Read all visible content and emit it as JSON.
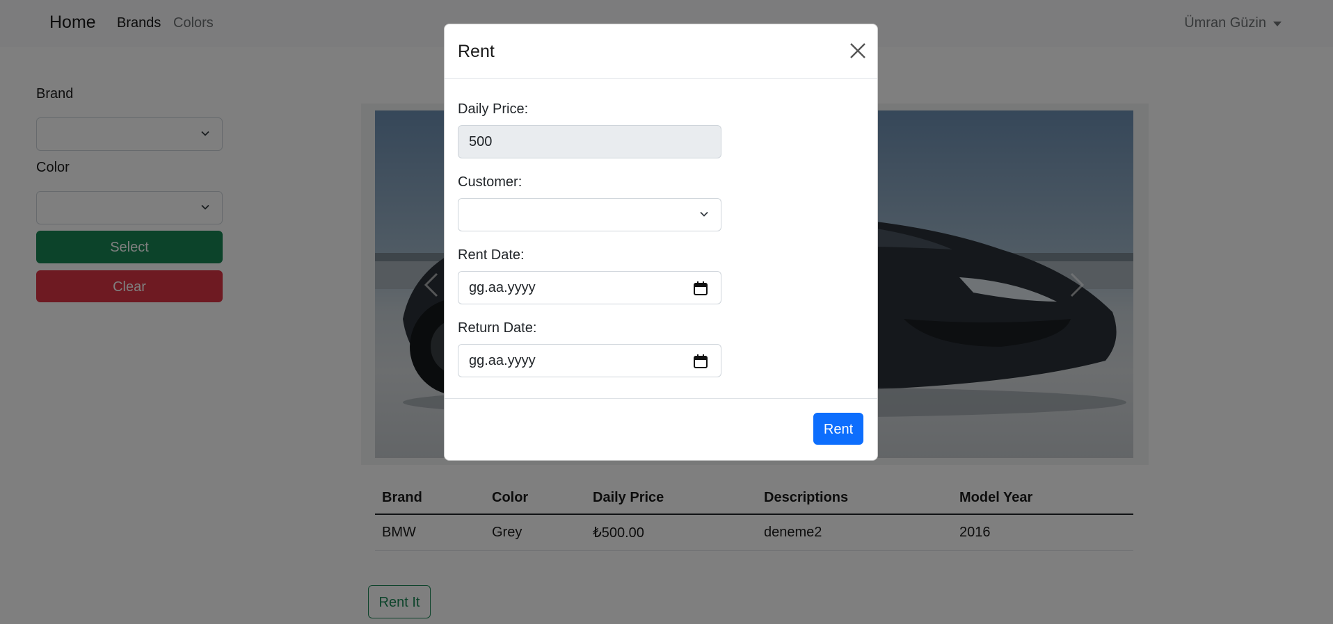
{
  "navbar": {
    "home_label": "Home",
    "links": [
      {
        "label": "Brands"
      },
      {
        "label": "Colors"
      }
    ],
    "user_name": "Ümran Güzin"
  },
  "filters": {
    "brand_label": "Brand",
    "brand_value": "",
    "color_label": "Color",
    "color_value": "",
    "select_button": "Select",
    "clear_button": "Clear"
  },
  "table": {
    "headers": [
      "Brand",
      "Color",
      "Daily Price",
      "Descriptions",
      "Model Year"
    ],
    "rows": [
      [
        "BMW",
        "Grey",
        "₺500.00",
        "deneme2",
        "2016"
      ]
    ]
  },
  "rent_it_button": "Rent It",
  "modal": {
    "title": "Rent",
    "daily_price_label": "Daily Price:",
    "daily_price_value": "500",
    "customer_label": "Customer:",
    "customer_value": "",
    "rent_date_label": "Rent Date:",
    "rent_date_placeholder": "gg.aa.yyyy",
    "return_date_label": "Return Date:",
    "return_date_placeholder": "gg.aa.yyyy",
    "submit_label": "Rent"
  },
  "colors": {
    "primary": "#0d6efd",
    "success": "#198754",
    "danger": "#dc3545",
    "backdrop": "rgba(0,0,0,0.5)"
  }
}
